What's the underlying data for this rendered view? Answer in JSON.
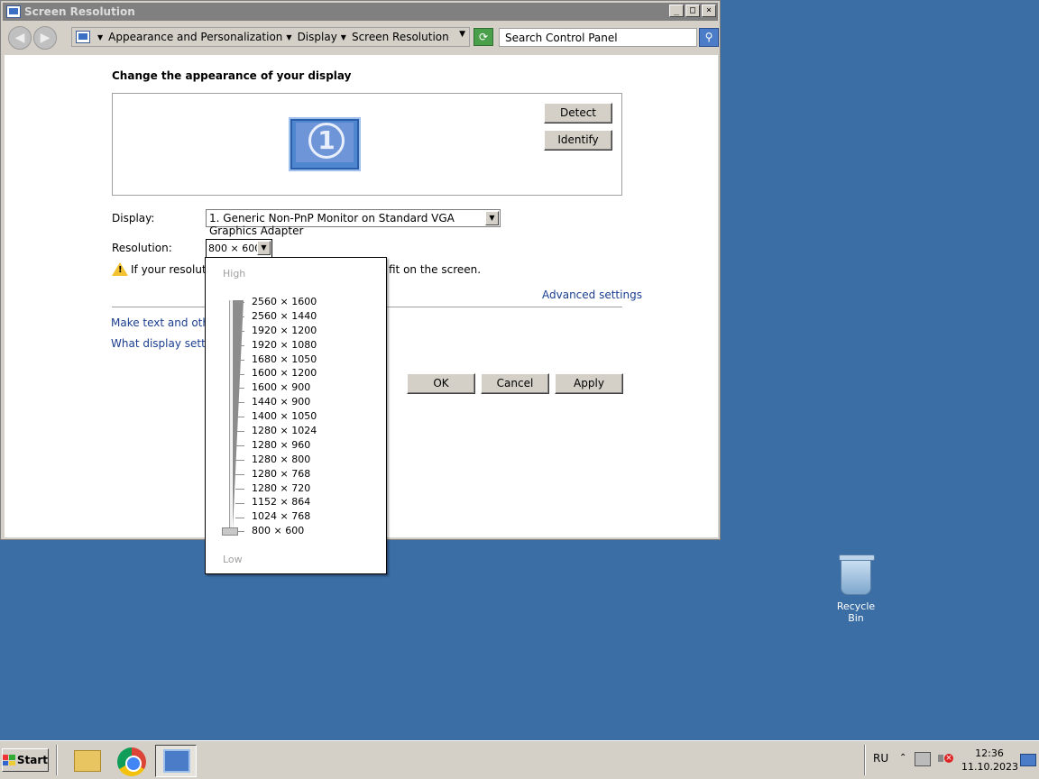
{
  "window": {
    "title": "Screen Resolution",
    "controls": {
      "minimize": "_",
      "maximize": "□",
      "close": "×"
    }
  },
  "nav": {
    "back_icon": "back-arrow-icon",
    "forward_icon": "forward-arrow-icon",
    "breadcrumbs": [
      "Appearance and Personalization",
      "Display",
      "Screen Resolution"
    ],
    "search_placeholder": "Search Control Panel"
  },
  "main": {
    "heading": "Change the appearance of your display",
    "monitor_number": "1",
    "detect_label": "Detect",
    "identify_label": "Identify",
    "display_label": "Display:",
    "display_value": "1. Generic Non-PnP Monitor on Standard VGA Graphics Adapter",
    "resolution_label": "Resolution:",
    "resolution_value": "800 × 600",
    "warning_text_a": "If your resolution",
    "warning_text_b": "fit on the screen.",
    "advanced_link": "Advanced settings",
    "link_text_size": "Make text and other it",
    "link_display_settings": "What display settings",
    "ok_label": "OK",
    "cancel_label": "Cancel",
    "apply_label": "Apply"
  },
  "resolution_popup": {
    "high_label": "High",
    "low_label": "Low",
    "options": [
      "2560 × 1600",
      "2560 × 1440",
      "1920 × 1200",
      "1920 × 1080",
      "1680 × 1050",
      "1600 × 1200",
      "1600 × 900",
      "1440 × 900",
      "1400 × 1050",
      "1280 × 1024",
      "1280 × 960",
      "1280 × 800",
      "1280 × 768",
      "1280 × 720",
      "1152 × 864",
      "1024 × 768",
      "800 × 600"
    ],
    "selected": "800 × 600"
  },
  "desktop": {
    "recycle_bin_label": "Recycle Bin"
  },
  "taskbar": {
    "start_label": "Start",
    "language": "RU",
    "time": "12:36",
    "date": "11.10.2023"
  },
  "colors": {
    "desktop": "#3b6ea5",
    "window_chrome": "#d4d0c8",
    "link": "#1a3d8f",
    "warning": "#f2c230"
  }
}
